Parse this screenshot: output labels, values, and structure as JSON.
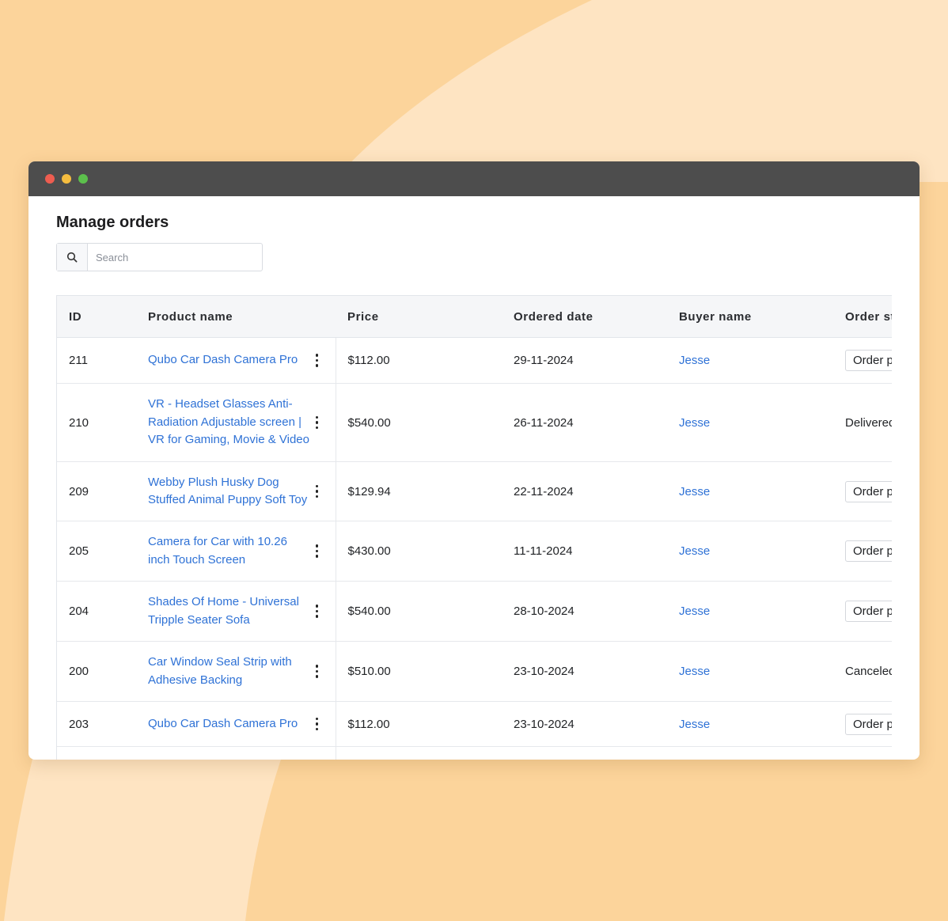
{
  "page": {
    "title": "Manage orders"
  },
  "search": {
    "placeholder": "Search",
    "value": ""
  },
  "table": {
    "columns": [
      "ID",
      "Product name",
      "Price",
      "Ordered date",
      "Buyer name",
      "Order status"
    ],
    "rows": [
      {
        "id": "211",
        "product": "Qubo Car Dash Camera Pro",
        "price": "$112.00",
        "date": "29-11-2024",
        "buyer": "Jesse",
        "status": "Order placed",
        "status_style": "badge"
      },
      {
        "id": "210",
        "product": "VR - Headset Glasses Anti-Radiation Adjustable screen | VR for Gaming, Movie & Video",
        "price": "$540.00",
        "date": "26-11-2024",
        "buyer": "Jesse",
        "status": "Delivered",
        "status_style": "text"
      },
      {
        "id": "209",
        "product": "Webby Plush Husky Dog Stuffed Animal Puppy Soft Toy",
        "price": "$129.94",
        "date": "22-11-2024",
        "buyer": "Jesse",
        "status": "Order placed",
        "status_style": "badge"
      },
      {
        "id": "205",
        "product": "Camera for Car with 10.26 inch Touch Screen",
        "price": "$430.00",
        "date": "11-11-2024",
        "buyer": "Jesse",
        "status": "Order placed",
        "status_style": "badge"
      },
      {
        "id": "204",
        "product": "Shades Of Home - Universal Tripple Seater Sofa",
        "price": "$540.00",
        "date": "28-10-2024",
        "buyer": "Jesse",
        "status": "Order placed",
        "status_style": "badge"
      },
      {
        "id": "200",
        "product": "Car Window Seal Strip with Adhesive Backing",
        "price": "$510.00",
        "date": "23-10-2024",
        "buyer": "Jesse",
        "status": "Canceled",
        "status_style": "text"
      },
      {
        "id": "203",
        "product": "Qubo Car Dash Camera Pro",
        "price": "$112.00",
        "date": "23-10-2024",
        "buyer": "Jesse",
        "status": "Order placed",
        "status_style": "badge"
      }
    ]
  },
  "colors": {
    "background": "#fcd49b",
    "background_light": "#fee4c2",
    "titlebar": "#4d4d4d",
    "link": "#2f72d6",
    "traffic_red": "#ee5d50",
    "traffic_yellow": "#f5bd3f",
    "traffic_green": "#5cc04c"
  }
}
